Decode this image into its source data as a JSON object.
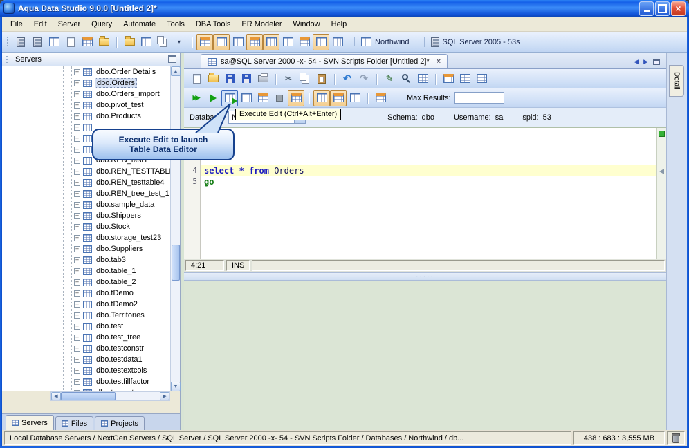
{
  "titlebar": {
    "title": "Aqua Data Studio 9.0.0 [Untitled 2]*"
  },
  "menubar": {
    "items": [
      {
        "label": "File",
        "name": "menu-file"
      },
      {
        "label": "Edit",
        "name": "menu-edit"
      },
      {
        "label": "Server",
        "name": "menu-server"
      },
      {
        "label": "Query",
        "name": "menu-query"
      },
      {
        "label": "Automate",
        "name": "menu-automate"
      },
      {
        "label": "Tools",
        "name": "menu-tools"
      },
      {
        "label": "DBA Tools",
        "name": "menu-dba-tools"
      },
      {
        "label": "ER Modeler",
        "name": "menu-er-modeler"
      },
      {
        "label": "Window",
        "name": "menu-window"
      },
      {
        "label": "Help",
        "name": "menu-help"
      }
    ]
  },
  "main_toolbar": {
    "group_a": [
      {
        "name": "register-server-icon",
        "cls": "ic-srv"
      },
      {
        "name": "connect-server-icon",
        "cls": "ic-srv"
      },
      {
        "name": "schema-browser-icon",
        "cls": "gi"
      },
      {
        "name": "query-analyzer-icon",
        "cls": "ic-doc"
      },
      {
        "name": "admin-tools-icon",
        "cls": "gi hdr"
      },
      {
        "name": "import-tool-icon",
        "cls": "ic-folder"
      },
      {
        "name": "export-tool-icon",
        "cls": "ic-folder",
        "btn": "gap"
      },
      {
        "name": "er-modeler-icon",
        "cls": "gi"
      },
      {
        "name": "schema-compare-icon",
        "cls": "ic-copy"
      },
      {
        "name": "open-recent-dropdown-icon",
        "glyph": "▾",
        "gcls": "caretg"
      }
    ],
    "group_b": [
      {
        "name": "view-toggle-grid-icon",
        "cls": "gi hdr",
        "btn": "pressed gap"
      },
      {
        "name": "view-toggle-text-icon",
        "cls": "gi",
        "btn": "pressed"
      },
      {
        "name": "view-toggle-form-icon",
        "cls": "gi"
      },
      {
        "name": "view-toggle-pivot-icon",
        "cls": "gi hdr",
        "btn": "pressed"
      },
      {
        "name": "view-toggle-chart-icon",
        "cls": "gi",
        "btn": "pressed"
      },
      {
        "name": "view-toggle-history-icon",
        "cls": "gi"
      },
      {
        "name": "view-toggle-bookmarks-icon",
        "cls": "gi hdr"
      },
      {
        "name": "view-toggle-messages-icon",
        "cls": "gi",
        "btn": "pressed"
      },
      {
        "name": "view-toggle-detail-icon",
        "cls": "gi"
      }
    ],
    "database_chip": "Northwind",
    "server_chip": "SQL Server 2005 - 53s"
  },
  "servers_panel": {
    "title": "Servers",
    "tree": [
      {
        "label": "dbo.Order Details"
      },
      {
        "label": "dbo.Orders",
        "cls": "sel"
      },
      {
        "label": "dbo.Orders_import"
      },
      {
        "label": "dbo.pivot_test"
      },
      {
        "label": "dbo.Products"
      },
      {
        "label": ""
      },
      {
        "label": ""
      },
      {
        "label": ""
      },
      {
        "label": "dbo.REN_test1"
      },
      {
        "label": "dbo.REN_TESTTABLE"
      },
      {
        "label": "dbo.REN_testtable4"
      },
      {
        "label": "dbo.REN_tree_test_1"
      },
      {
        "label": "dbo.sample_data"
      },
      {
        "label": "dbo.Shippers"
      },
      {
        "label": "dbo.Stock"
      },
      {
        "label": "dbo.storage_test23"
      },
      {
        "label": "dbo.Suppliers"
      },
      {
        "label": "dbo.tab3"
      },
      {
        "label": "dbo.table_1"
      },
      {
        "label": "dbo.table_2"
      },
      {
        "label": "dbo.tDemo"
      },
      {
        "label": "dbo.tDemo2"
      },
      {
        "label": "dbo.Territories"
      },
      {
        "label": "dbo.test"
      },
      {
        "label": "dbo.test_tree"
      },
      {
        "label": "dbo.testconstr"
      },
      {
        "label": "dbo.testdata1"
      },
      {
        "label": "dbo.testextcols"
      },
      {
        "label": "dbo.testfillfactor"
      },
      {
        "label": "dbo.testopts"
      }
    ],
    "tabs": [
      {
        "label": "Servers",
        "name": "panel-tab-servers",
        "cls": "active"
      },
      {
        "label": "Files",
        "name": "panel-tab-files"
      },
      {
        "label": "Projects",
        "name": "panel-tab-projects"
      }
    ]
  },
  "document": {
    "tab_title": "sa@SQL Server 2000 -x- 54 - SVN Scripts Folder [Untitled 2]*"
  },
  "query_toolbar_1": {
    "items": [
      {
        "name": "new-file-icon",
        "cls": "ic-doc"
      },
      {
        "name": "open-file-icon",
        "cls": "ic-folder"
      },
      {
        "name": "save-icon",
        "cls": "ic-save"
      },
      {
        "name": "save-all-icon",
        "cls": "ic-save"
      },
      {
        "name": "print-icon",
        "cls": "ic-print"
      },
      {
        "name": "cut-icon",
        "glyph": "✂",
        "gcls": "g-cut",
        "btn": "gap"
      },
      {
        "name": "copy-icon",
        "cls": "ic-copy"
      },
      {
        "name": "paste-icon",
        "cls": "ic-paste"
      },
      {
        "name": "undo-icon",
        "glyph": "↶",
        "gcls": "g-undo",
        "btn": "gap"
      },
      {
        "name": "redo-icon",
        "glyph": "↷",
        "gcls": "g-redo"
      },
      {
        "name": "format-sql-icon",
        "glyph": "✎",
        "gcls": "g-pencil",
        "btn": "gap"
      },
      {
        "name": "find-icon",
        "cls": "ic-find"
      },
      {
        "name": "syntax-check-icon",
        "cls": "gi"
      },
      {
        "name": "describe-icon",
        "cls": "gi hdr",
        "btn": "gap"
      },
      {
        "name": "sql-history-icon",
        "cls": "gi"
      },
      {
        "name": "auto-complete-icon",
        "cls": "gi"
      }
    ]
  },
  "query_toolbar_2": {
    "items": [
      {
        "name": "execute-icon",
        "glyph": "▶▶",
        "gcls": "g-ff"
      },
      {
        "name": "execute-current-icon",
        "cls": "ic-play"
      },
      {
        "name": "execute-edit-icon",
        "cls": "gi run",
        "btn": "hl"
      },
      {
        "name": "execute-explain-icon",
        "cls": "gi"
      },
      {
        "name": "explain-plan-icon",
        "cls": "gi hdr"
      },
      {
        "name": "stop-icon",
        "cls": "ic-stop"
      },
      {
        "name": "auto-commit-icon",
        "cls": "gi hdr",
        "btn": "pressed"
      },
      {
        "name": "results-grid-icon",
        "cls": "gi",
        "btn": "pressed gap"
      },
      {
        "name": "results-text-icon",
        "cls": "gi hdr",
        "btn": "pressed"
      },
      {
        "name": "results-file-icon",
        "cls": "gi"
      },
      {
        "name": "export-results-icon",
        "cls": "gi hdr",
        "btn": "gap"
      }
    ],
    "max_results_label": "Max Results:",
    "max_results_value": ""
  },
  "context_bar": {
    "database_label": "Database:",
    "database_value": "Northwind",
    "schema_label": "Schema:",
    "schema_value": "dbo",
    "username_label": "Username:",
    "username_value": "sa",
    "spid_label": "spid:",
    "spid_value": "53"
  },
  "tooltip": {
    "text": "Execute Edit (Ctrl+Alt+Enter)"
  },
  "callout": {
    "line1": "Execute Edit to launch",
    "line2": "Table Data Editor"
  },
  "editor": {
    "line4_number": "4",
    "line5_number": "5",
    "code": {
      "kw1": "select",
      "star": "*",
      "kw2": "from",
      "table": "Orders",
      "go": "go"
    },
    "status_position": "4:21",
    "status_mode": "INS"
  },
  "splitter": {
    "grip": "·····"
  },
  "detail_tab": {
    "label": "Detail"
  },
  "statusbar": {
    "breadcrumb": "Local Database Servers / NextGen Servers / SQL Server / SQL Server 2000 -x- 54 - SVN Scripts Folder / Databases / Northwind / db...",
    "memory": "438 : 683 : 3,555 MB"
  },
  "icons": {
    "expand_plus": "+",
    "dropdown_caret": "▾",
    "close": "×",
    "scroll_up": "▲",
    "scroll_down": "▼",
    "scroll_left": "◀",
    "scroll_right": "▶",
    "nav_left": "◀",
    "nav_right": "▶"
  }
}
